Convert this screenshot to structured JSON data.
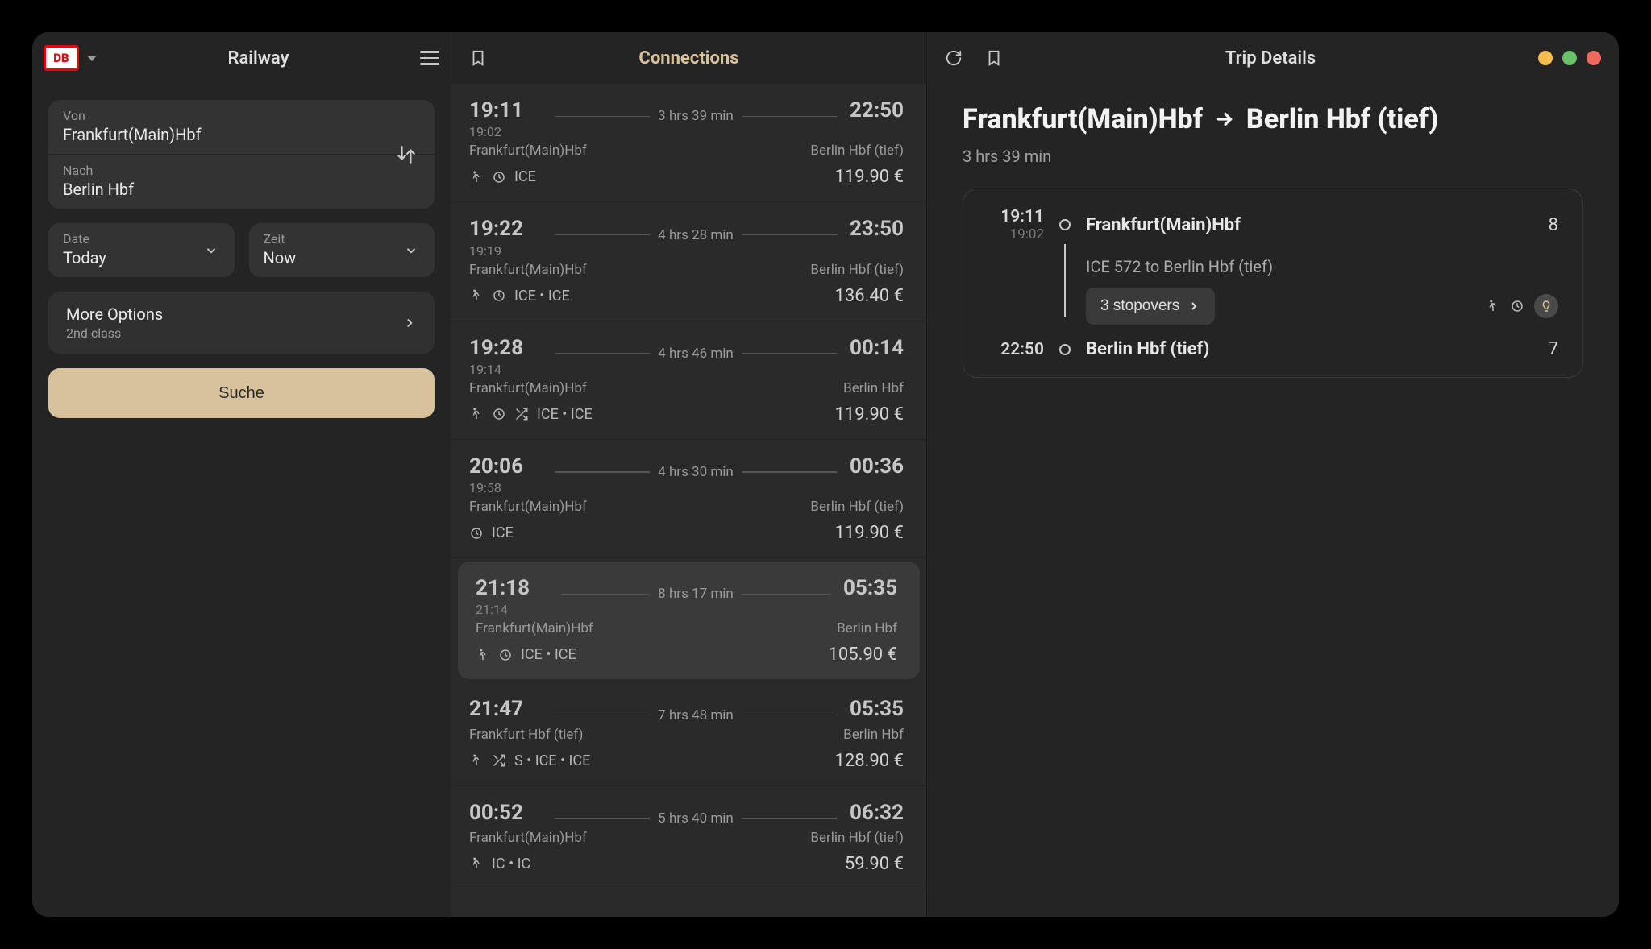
{
  "sidebar": {
    "app_title": "Railway",
    "logo_text": "DB",
    "from_label": "Von",
    "from_value": "Frankfurt(Main)Hbf",
    "to_label": "Nach",
    "to_value": "Berlin Hbf",
    "date_label": "Date",
    "date_value": "Today",
    "time_label": "Zeit",
    "time_value": "Now",
    "more_options_label": "More Options",
    "more_options_sub": "2nd class",
    "search_label": "Suche"
  },
  "connections": {
    "title": "Connections",
    "items": [
      {
        "dep": "19:11",
        "dep_delay": "19:02",
        "arr": "22:50",
        "dur": "3 hrs 39 min",
        "from": "Frankfurt(Main)Hbf",
        "to": "Berlin Hbf (tief)",
        "price": "119.90 €",
        "icons": [
          "walk",
          "load",
          "ICE"
        ]
      },
      {
        "dep": "19:22",
        "dep_delay": "19:19",
        "arr": "23:50",
        "dur": "4 hrs 28 min",
        "from": "Frankfurt(Main)Hbf",
        "to": "Berlin Hbf (tief)",
        "price": "136.40 €",
        "icons": [
          "walk",
          "load",
          "ICE • ICE"
        ]
      },
      {
        "dep": "19:28",
        "dep_delay": "19:14",
        "arr": "00:14",
        "dur": "4 hrs 46 min",
        "from": "Frankfurt(Main)Hbf",
        "to": "Berlin Hbf",
        "price": "119.90 €",
        "icons": [
          "walk",
          "load",
          "shuffle",
          "ICE • ICE"
        ]
      },
      {
        "dep": "20:06",
        "dep_delay": "19:58",
        "arr": "00:36",
        "dur": "4 hrs 30 min",
        "from": "Frankfurt(Main)Hbf",
        "to": "Berlin Hbf (tief)",
        "price": "119.90 €",
        "icons": [
          "load",
          "ICE"
        ]
      },
      {
        "dep": "21:18",
        "dep_delay": "21:14",
        "arr": "05:35",
        "dur": "8 hrs 17 min",
        "from": "Frankfurt(Main)Hbf",
        "to": "Berlin Hbf",
        "price": "105.90 €",
        "icons": [
          "walk",
          "load",
          "ICE • ICE"
        ],
        "selected": true
      },
      {
        "dep": "21:47",
        "dep_delay": "",
        "arr": "05:35",
        "dur": "7 hrs 48 min",
        "from": "Frankfurt Hbf (tief)",
        "to": "Berlin Hbf",
        "price": "128.90 €",
        "icons": [
          "walk",
          "shuffle",
          "S • ICE • ICE"
        ]
      },
      {
        "dep": "00:52",
        "dep_delay": "",
        "arr": "06:32",
        "dur": "5 hrs 40 min",
        "from": "Frankfurt(Main)Hbf",
        "to": "Berlin Hbf (tief)",
        "price": "59.90 €",
        "icons": [
          "walk",
          "IC • IC"
        ]
      }
    ]
  },
  "details": {
    "title": "Trip Details",
    "route_from": "Frankfurt(Main)Hbf",
    "route_to": "Berlin Hbf (tief)",
    "total_dur": "3 hrs 39 min",
    "segment": {
      "dep_time": "19:11",
      "dep_delay": "19:02",
      "dep_station": "Frankfurt(Main)Hbf",
      "dep_platform": "8",
      "train_line": "ICE 572 to Berlin Hbf (tief)",
      "stopovers_label": "3 stopovers",
      "arr_time": "22:50",
      "arr_station": "Berlin Hbf (tief)",
      "arr_platform": "7"
    }
  }
}
